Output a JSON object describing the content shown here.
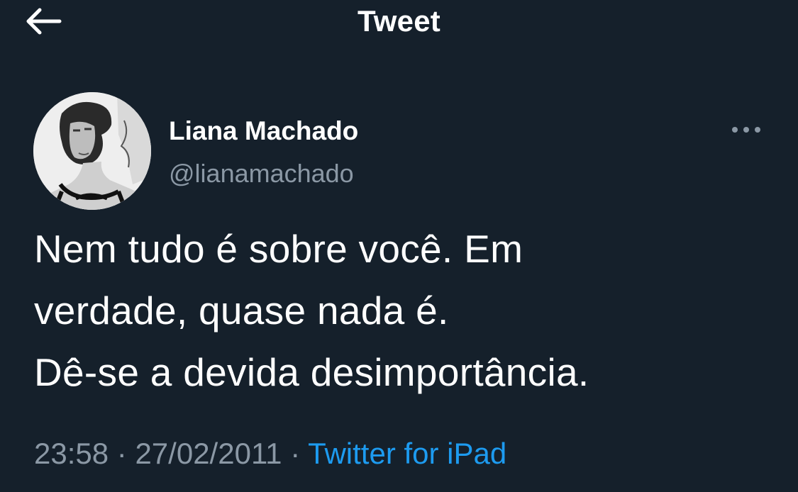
{
  "header": {
    "title": "Tweet",
    "back_icon": "arrow-left-icon"
  },
  "tweet": {
    "author": {
      "display_name": "Liana Machado",
      "handle": "@lianamachado",
      "avatar_icon": "profile-photo"
    },
    "more_icon": "more-horizontal-icon",
    "text_lines": [
      "Nem tudo é sobre você. Em",
      "verdade, quase nada é.",
      "Dê-se a devida desimportância."
    ],
    "time": "23:58",
    "separator": "·",
    "date": "27/02/2011",
    "source": "Twitter for iPad"
  },
  "colors": {
    "background": "#15202b",
    "primary_text": "#ffffff",
    "secondary_text": "#8b98a5",
    "link": "#1d9bf0"
  }
}
